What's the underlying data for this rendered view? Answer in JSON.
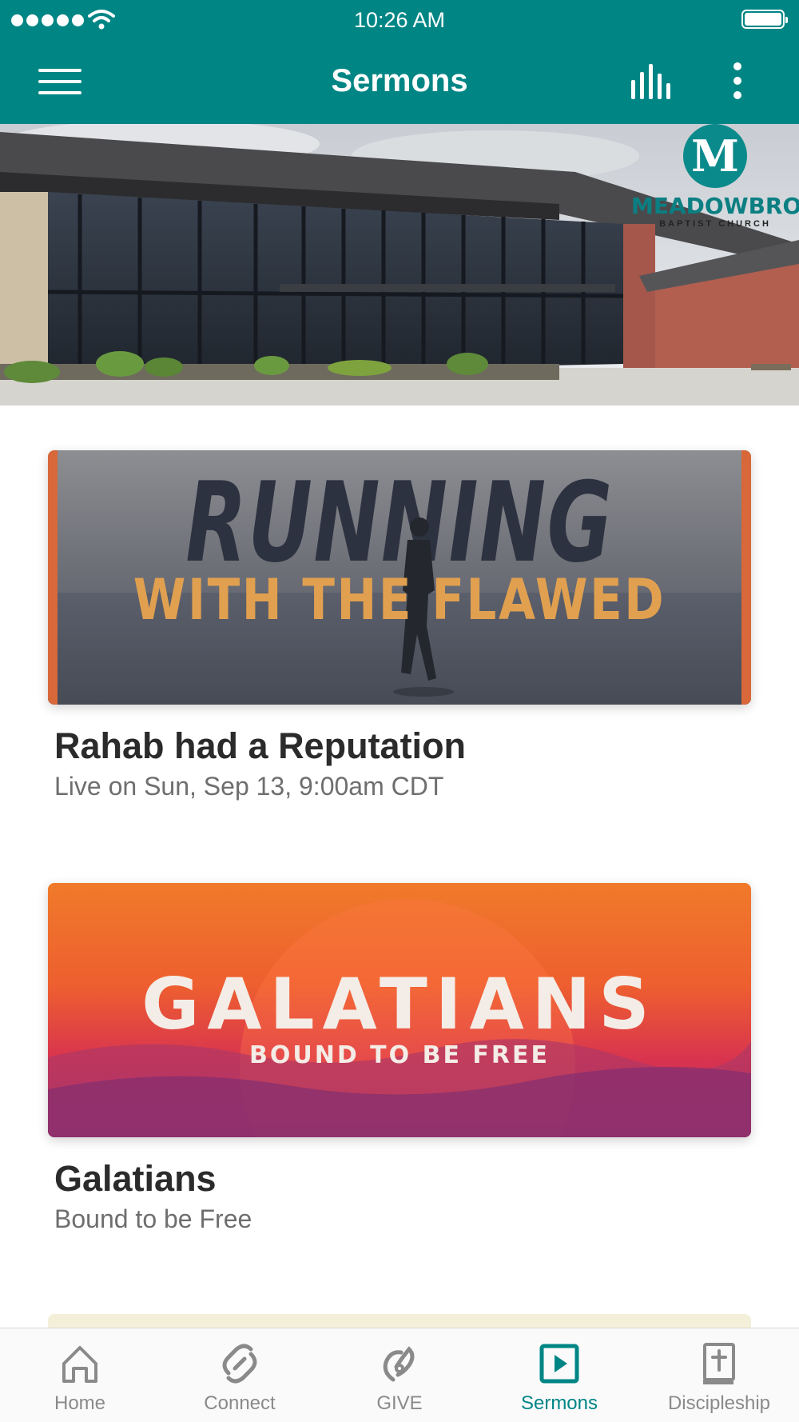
{
  "status_bar": {
    "time": "10:26 AM",
    "signal_bars": 5,
    "wifi": "wifi-icon",
    "battery": "battery-full-icon"
  },
  "header": {
    "title": "Sermons",
    "menu_icon": "hamburger-menu-icon",
    "audio_icon": "audio-bars-icon",
    "more_icon": "more-vertical-icon"
  },
  "banner": {
    "logo_letter": "M",
    "church_name": "MEADOWBROOK",
    "church_subtitle": "BAPTIST CHURCH"
  },
  "sermons": [
    {
      "art_title_line1": "RUNNING",
      "art_title_line2": "WITH THE FLAWED",
      "title": "Rahab had a Reputation",
      "subtitle": "Live on Sun, Sep 13, 9:00am CDT"
    },
    {
      "art_title_line1": "GALATIANS",
      "art_title_line2": "BOUND TO BE FREE",
      "title": "Galatians",
      "subtitle": "Bound to be Free"
    }
  ],
  "tabbar": {
    "tabs": [
      {
        "label": "Home",
        "icon": "home-icon",
        "active": false
      },
      {
        "label": "Connect",
        "icon": "connect-icon",
        "active": false
      },
      {
        "label": "GIVE",
        "icon": "give-icon",
        "active": false
      },
      {
        "label": "Sermons",
        "icon": "play-square-icon",
        "active": true
      },
      {
        "label": "Discipleship",
        "icon": "bible-icon",
        "active": false
      }
    ],
    "active_color": "#008585",
    "inactive_color": "#8a8a8a"
  },
  "colors": {
    "brand": "#008585"
  }
}
